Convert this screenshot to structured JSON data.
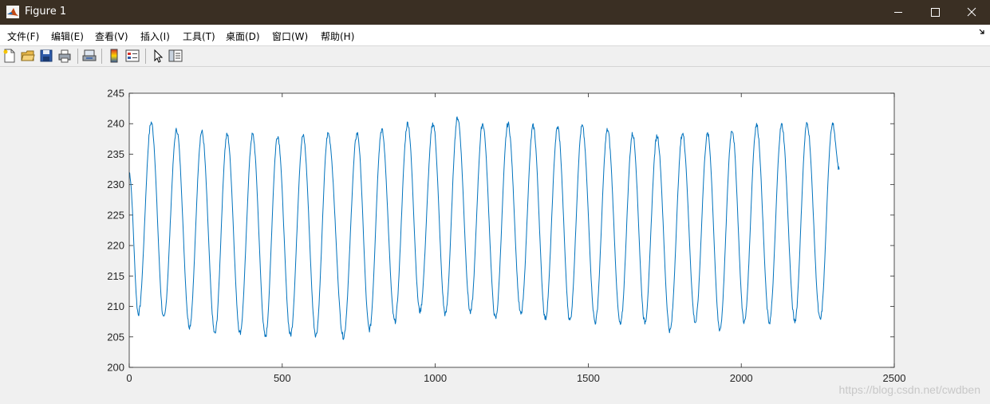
{
  "window": {
    "title": "Figure 1",
    "buttons": [
      "minimize",
      "maximize",
      "close"
    ]
  },
  "menu": {
    "items": [
      "文件(F)",
      "编辑(E)",
      "查看(V)",
      "插入(I)",
      "工具(T)",
      "桌面(D)",
      "窗口(W)",
      "帮助(H)"
    ]
  },
  "toolbar": {
    "icons": [
      "new-figure-icon",
      "open-file-icon",
      "save-icon",
      "print-icon",
      "link-plot-icon",
      "insert-colorbar-icon",
      "insert-legend-icon",
      "edit-plot-icon",
      "property-inspector-icon"
    ]
  },
  "colors": {
    "line": "#0072bd",
    "titlebar": "#3a2f23",
    "background": "#f0f0f0"
  },
  "watermark": "https://blog.csdn.net/cwdben",
  "chart_data": {
    "type": "line",
    "title": "",
    "xlabel": "",
    "ylabel": "",
    "xlim": [
      0,
      2500
    ],
    "ylim": [
      200,
      245
    ],
    "xticks": [
      0,
      500,
      1000,
      1500,
      2000,
      2500
    ],
    "yticks": [
      200,
      205,
      210,
      215,
      220,
      225,
      230,
      235,
      240,
      245
    ],
    "grid": false,
    "series": [
      {
        "name": "",
        "color": "#0072bd",
        "start": {
          "x": 0,
          "y": 232
        },
        "end": {
          "x": 2320,
          "y": 232.5
        },
        "peaks": [
          {
            "x": 72,
            "y": 240.2
          },
          {
            "x": 155,
            "y": 239.0
          },
          {
            "x": 237,
            "y": 238.7
          },
          {
            "x": 320,
            "y": 238.2
          },
          {
            "x": 403,
            "y": 238.2
          },
          {
            "x": 485,
            "y": 238.0
          },
          {
            "x": 568,
            "y": 238.0
          },
          {
            "x": 650,
            "y": 238.4
          },
          {
            "x": 745,
            "y": 238.4
          },
          {
            "x": 825,
            "y": 239.0
          },
          {
            "x": 910,
            "y": 240.1
          },
          {
            "x": 993,
            "y": 240.0
          },
          {
            "x": 1073,
            "y": 241.0
          },
          {
            "x": 1155,
            "y": 240.0
          },
          {
            "x": 1238,
            "y": 240.0
          },
          {
            "x": 1320,
            "y": 239.6
          },
          {
            "x": 1400,
            "y": 239.4
          },
          {
            "x": 1480,
            "y": 239.6
          },
          {
            "x": 1563,
            "y": 239.0
          },
          {
            "x": 1645,
            "y": 238.3
          },
          {
            "x": 1725,
            "y": 238.0
          },
          {
            "x": 1808,
            "y": 238.4
          },
          {
            "x": 1890,
            "y": 238.3
          },
          {
            "x": 1970,
            "y": 239.0
          },
          {
            "x": 2050,
            "y": 239.8
          },
          {
            "x": 2132,
            "y": 239.8
          },
          {
            "x": 2215,
            "y": 240.0
          },
          {
            "x": 2298,
            "y": 240.0
          }
        ],
        "troughs": [
          {
            "x": 30,
            "y": 208.8
          },
          {
            "x": 113,
            "y": 208.0
          },
          {
            "x": 197,
            "y": 206.7
          },
          {
            "x": 280,
            "y": 205.5
          },
          {
            "x": 362,
            "y": 205.7
          },
          {
            "x": 445,
            "y": 205.0
          },
          {
            "x": 527,
            "y": 205.3
          },
          {
            "x": 610,
            "y": 205.3
          },
          {
            "x": 700,
            "y": 205.0
          },
          {
            "x": 785,
            "y": 206.2
          },
          {
            "x": 868,
            "y": 207.5
          },
          {
            "x": 950,
            "y": 209.2
          },
          {
            "x": 1033,
            "y": 208.7
          },
          {
            "x": 1115,
            "y": 209.0
          },
          {
            "x": 1197,
            "y": 208.0
          },
          {
            "x": 1280,
            "y": 208.7
          },
          {
            "x": 1360,
            "y": 208.0
          },
          {
            "x": 1440,
            "y": 207.7
          },
          {
            "x": 1523,
            "y": 207.4
          },
          {
            "x": 1605,
            "y": 207.0
          },
          {
            "x": 1685,
            "y": 207.4
          },
          {
            "x": 1767,
            "y": 206.0
          },
          {
            "x": 1850,
            "y": 207.4
          },
          {
            "x": 1930,
            "y": 206.2
          },
          {
            "x": 2010,
            "y": 207.4
          },
          {
            "x": 2092,
            "y": 207.4
          },
          {
            "x": 2175,
            "y": 207.6
          },
          {
            "x": 2258,
            "y": 207.8
          }
        ]
      }
    ]
  }
}
